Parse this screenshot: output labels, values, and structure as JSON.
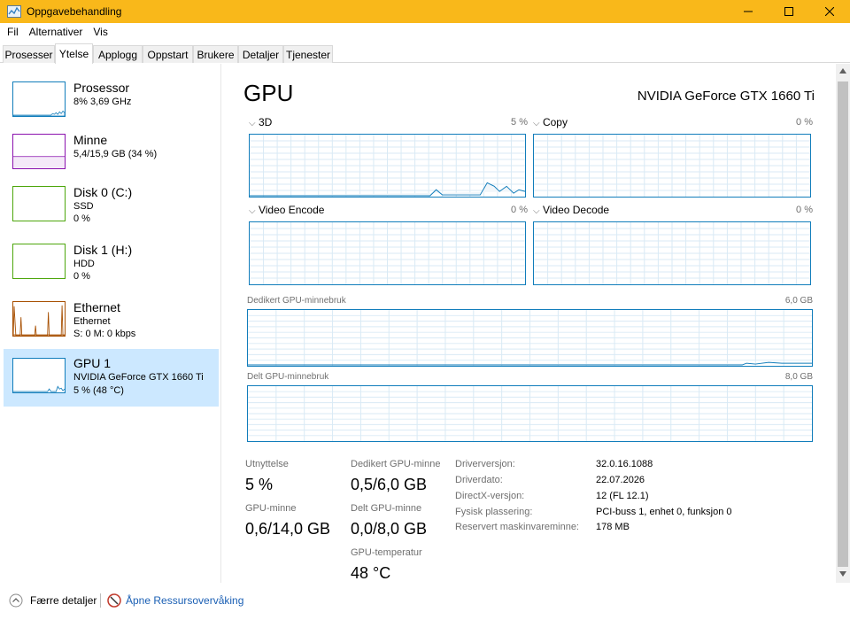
{
  "window": {
    "title": "Oppgavebehandling"
  },
  "menu": [
    "Fil",
    "Alternativer",
    "Vis"
  ],
  "tabs": [
    "Prosesser",
    "Ytelse",
    "Applogg",
    "Oppstart",
    "Brukere",
    "Detaljer",
    "Tjenester"
  ],
  "resources": [
    {
      "name": "Prosessor",
      "lines": [
        "8%  3,69 GHz"
      ],
      "color": "#117dbb"
    },
    {
      "name": "Minne",
      "lines": [
        "5,4/15,9 GB (34 %)"
      ],
      "color": "#8b12ae"
    },
    {
      "name": "Disk 0 (C:)",
      "lines": [
        "SSD",
        "0 %"
      ],
      "color": "#4da60c"
    },
    {
      "name": "Disk 1 (H:)",
      "lines": [
        "HDD",
        "0 %"
      ],
      "color": "#4da60c"
    },
    {
      "name": "Ethernet",
      "lines": [
        "Ethernet",
        "S: 0  M: 0 kbps"
      ],
      "color": "#a74f01"
    },
    {
      "name": "GPU 1",
      "lines": [
        "NVIDIA GeForce GTX 1660 Ti",
        "5 %  (48 °C)"
      ],
      "color": "#117dbb"
    }
  ],
  "gpu": {
    "title": "GPU",
    "model": "NVIDIA GeForce GTX 1660 Ti",
    "engines": [
      {
        "label": "3D",
        "value": "5 %"
      },
      {
        "label": "Copy",
        "value": "0 %"
      },
      {
        "label": "Video Encode",
        "value": "0 %"
      },
      {
        "label": "Video Decode",
        "value": "0 %"
      }
    ],
    "dedicated_mem": {
      "label": "Dedikert GPU-minnebruk",
      "max": "6,0 GB"
    },
    "shared_mem": {
      "label": "Delt GPU-minnebruk",
      "max": "8,0 GB"
    }
  },
  "stats": {
    "utilization": {
      "label": "Utnyttelse",
      "value": "5 %"
    },
    "gpu_memory": {
      "label": "GPU-minne",
      "value": "0,6/14,0 GB"
    },
    "dedicated": {
      "label": "Dedikert GPU-minne",
      "value": "0,5/6,0 GB"
    },
    "shared": {
      "label": "Delt GPU-minne",
      "value": "0,0/8,0 GB"
    },
    "temperature": {
      "label": "GPU-temperatur",
      "value": "48 °C"
    }
  },
  "info": [
    {
      "label": "Driverversjon:",
      "value": "32.0.16.1088"
    },
    {
      "label": "Driverdato:",
      "value": "22.07.2026"
    },
    {
      "label": "DirectX-versjon:",
      "value": "12 (FL 12.1)"
    },
    {
      "label": "Fysisk plassering:",
      "value": "PCI-buss 1, enhet 0, funksjon 0"
    },
    {
      "label": "Reservert maskinvareminne:",
      "value": "178 MB"
    }
  ],
  "bottom": {
    "fewer_details": "Færre detaljer",
    "resource_monitor": "Åpne Ressursovervåking"
  },
  "colors": {
    "titlebar": "#f9b81a",
    "graph_border": "#117dbb",
    "selected_bg": "#cce8ff",
    "link": "#1a5fb4"
  }
}
